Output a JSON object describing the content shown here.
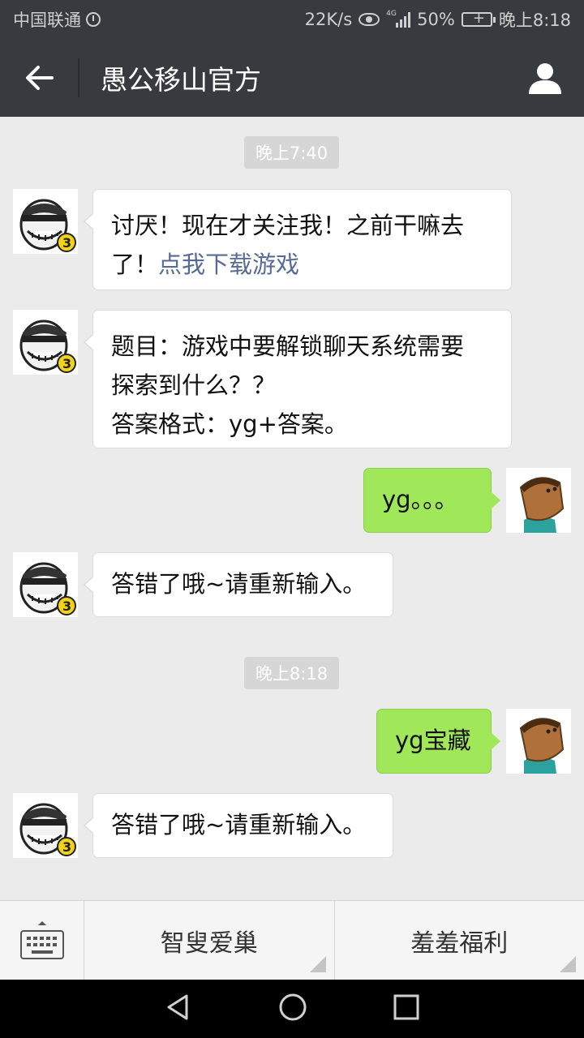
{
  "status_bar": {
    "carrier": "中国联通",
    "net_speed": "22K/s",
    "network_type": "4G",
    "battery": "50%",
    "time": "晚上8:18"
  },
  "header": {
    "title": "愚公移山官方"
  },
  "messages": [
    {
      "type": "time",
      "text": "晚上7:40"
    },
    {
      "type": "in",
      "text": "讨厌！现在才关注我！之前干嘛去了！",
      "link": "点我下载游戏"
    },
    {
      "type": "in",
      "lines": [
        "题目：游戏中要解锁聊天系统需要",
        "探索到什么？？",
        "答案格式：yg+答案。"
      ]
    },
    {
      "type": "out",
      "text": "yg。。。"
    },
    {
      "type": "in",
      "text": "答错了哦~请重新输入。"
    },
    {
      "type": "time",
      "text": "晚上8:18"
    },
    {
      "type": "out",
      "text": "yg宝藏"
    },
    {
      "type": "in",
      "text": "答错了哦~请重新输入。"
    }
  ],
  "bottom_menu": {
    "items": [
      "智叟爱巢",
      "羞羞福利"
    ]
  },
  "colors": {
    "bar": "#393a3f",
    "chat_bg": "#ebebeb",
    "out_bubble": "#a0e75a",
    "link": "#576b95"
  }
}
